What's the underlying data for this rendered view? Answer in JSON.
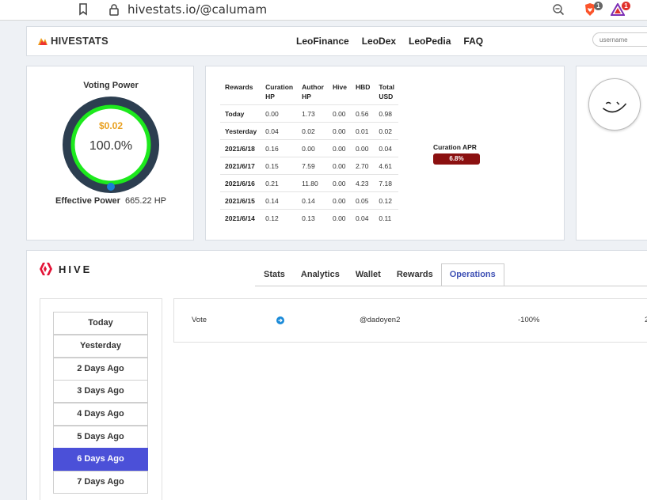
{
  "browser": {
    "url": "hivestats.io/@calumam",
    "brave_badge": "1",
    "rewards_badge": "1"
  },
  "header": {
    "logo_text": "HIVESTATS",
    "nav": [
      "LeoFinance",
      "LeoDex",
      "LeoPedia",
      "FAQ"
    ],
    "username_placeholder": "username"
  },
  "voting_power": {
    "title": "Voting Power",
    "value_usd": "$0.02",
    "percent": "100.0%",
    "percent_value": 100,
    "effective_label": "Effective Power",
    "effective_value": "665.22 HP"
  },
  "rewards_table": {
    "headers": [
      "Rewards",
      "Curation HP",
      "Author HP",
      "Hive",
      "HBD",
      "Total USD"
    ],
    "header_lines": [
      [
        "Rewards"
      ],
      [
        "Curation",
        "HP"
      ],
      [
        "Author",
        "HP"
      ],
      [
        "Hive"
      ],
      [
        "HBD"
      ],
      [
        "Total",
        "USD"
      ]
    ],
    "rows": [
      [
        "Today",
        "0.00",
        "1.73",
        "0.00",
        "0.56",
        "0.98"
      ],
      [
        "Yesterday",
        "0.04",
        "0.02",
        "0.00",
        "0.01",
        "0.02"
      ],
      [
        "2021/6/18",
        "0.16",
        "0.00",
        "0.00",
        "0.00",
        "0.04"
      ],
      [
        "2021/6/17",
        "0.15",
        "7.59",
        "0.00",
        "2.70",
        "4.61"
      ],
      [
        "2021/6/16",
        "0.21",
        "11.80",
        "0.00",
        "4.23",
        "7.18"
      ],
      [
        "2021/6/15",
        "0.14",
        "0.14",
        "0.00",
        "0.05",
        "0.12"
      ],
      [
        "2021/6/14",
        "0.12",
        "0.13",
        "0.00",
        "0.04",
        "0.11"
      ]
    ]
  },
  "curation_apr": {
    "label": "Curation APR",
    "value": "6.8%"
  },
  "hive_section": {
    "logo_text": "HIVE",
    "tabs": [
      "Stats",
      "Analytics",
      "Wallet",
      "Rewards",
      "Operations"
    ],
    "active_tab": "Operations",
    "days": [
      "Today",
      "Yesterday",
      "2 Days Ago",
      "3 Days Ago",
      "4 Days Ago",
      "5 Days Ago",
      "6 Days Ago",
      "7 Days Ago"
    ],
    "selected_day": "6 Days Ago",
    "operation": {
      "type": "Vote",
      "icon": "arrow-right-circle-icon",
      "user": "@dadoyen2",
      "weight": "-100%",
      "extra": "2"
    }
  },
  "colors": {
    "gauge_ring": "#2c3e50",
    "gauge_fill": "#1de91d",
    "gauge_marker": "#1a7fd4",
    "money": "#e8a020",
    "apr_badge": "#8b1010",
    "selected_day": "#4b50d8",
    "active_tab": "#3f51b5"
  }
}
